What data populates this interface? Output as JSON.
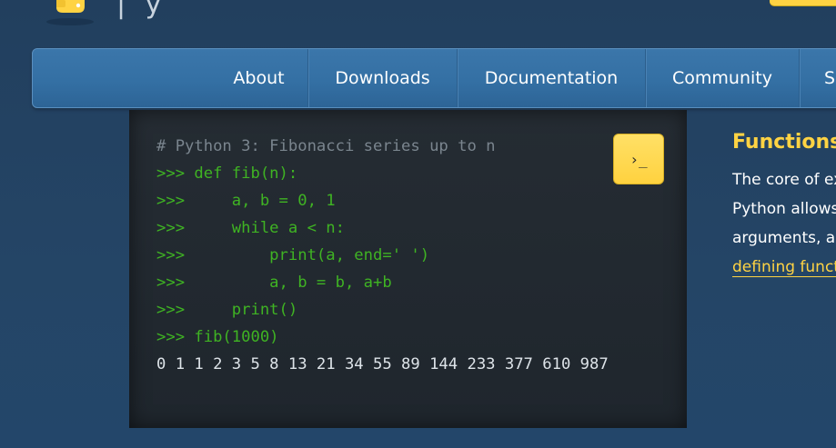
{
  "header": {
    "logo_icon": "python-logo-icon",
    "logo_glyph": "| y",
    "accent_color": "#ffd343"
  },
  "nav": {
    "items": [
      {
        "label": "About"
      },
      {
        "label": "Downloads"
      },
      {
        "label": "Documentation"
      },
      {
        "label": "Community"
      },
      {
        "label": "S"
      }
    ]
  },
  "code_sample": {
    "lines": [
      {
        "kind": "comment",
        "text": "# Python 3: Fibonacci series up to n"
      },
      {
        "kind": "code",
        "text": ">>> def fib(n):"
      },
      {
        "kind": "code",
        "text": ">>>     a, b = 0, 1"
      },
      {
        "kind": "code",
        "text": ">>>     while a < n:"
      },
      {
        "kind": "code",
        "text": ">>>         print(a, end=' ')"
      },
      {
        "kind": "code",
        "text": ">>>         a, b = b, a+b"
      },
      {
        "kind": "code",
        "text": ">>>     print()"
      },
      {
        "kind": "code",
        "text": ">>> fib(1000)"
      },
      {
        "kind": "output",
        "text": "0 1 1 2 3 5 8 13 21 34 55 89 144 233 377 610 987"
      }
    ],
    "shell_button_label": "›_",
    "shell_button_icon": "terminal-prompt-icon",
    "colors": {
      "comment": "#7a858e",
      "code": "#3fb323",
      "output": "#dde3e8"
    }
  },
  "feature": {
    "title": "Functions",
    "lines": [
      "The core of ex",
      "Python allows",
      "arguments, ar"
    ],
    "link": "defining funct"
  }
}
